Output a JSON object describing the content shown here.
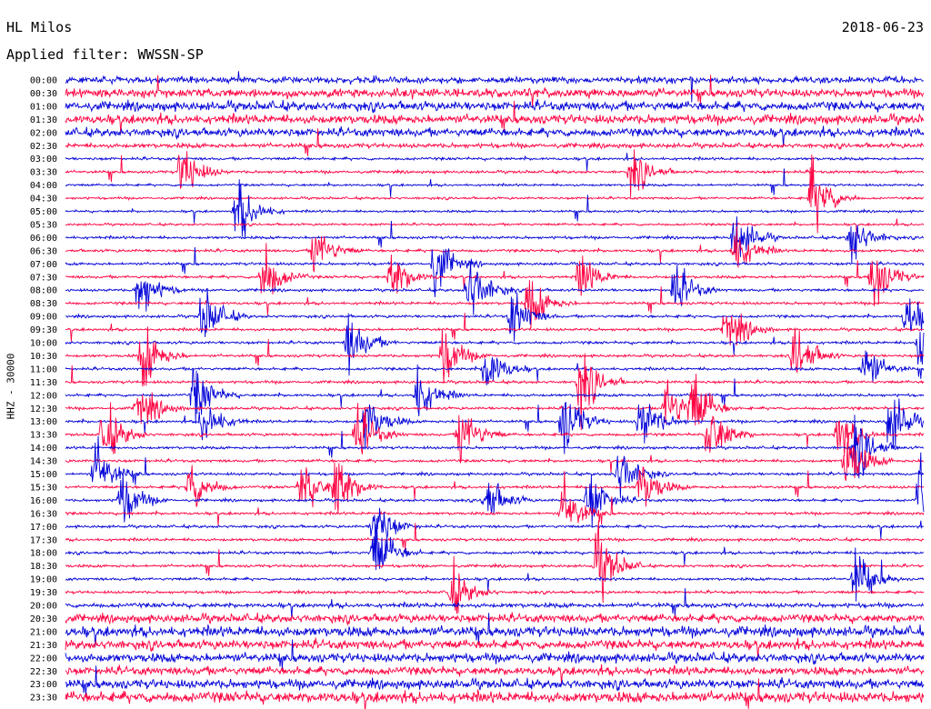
{
  "header": {
    "station": "HL Milos",
    "date": "2018-06-23",
    "filter": "Applied filter: WWSSN-SP",
    "channel": "HHZ - 30000"
  },
  "colors": {
    "trace_a": "#0000d8",
    "trace_b": "#ff0040",
    "background": "#ffffff"
  },
  "chart_data": {
    "type": "line",
    "title": "HL Milos",
    "subtitle": "Applied filter: WWSSN-SP",
    "ylabel": "HHZ - 30000",
    "y_ticks": [
      "00:00",
      "00:30",
      "01:00",
      "01:30",
      "02:00",
      "02:30",
      "03:00",
      "03:30",
      "04:00",
      "04:30",
      "05:00",
      "05:30",
      "06:00",
      "06:30",
      "07:00",
      "07:30",
      "08:00",
      "08:30",
      "09:00",
      "09:30",
      "10:00",
      "10:30",
      "11:00",
      "11:30",
      "12:00",
      "12:30",
      "13:00",
      "13:30",
      "14:00",
      "14:30",
      "15:00",
      "15:30",
      "16:00",
      "16:30",
      "17:00",
      "17:30",
      "18:00",
      "18:30",
      "19:00",
      "19:30",
      "20:00",
      "20:30",
      "21:00",
      "21:30",
      "22:00",
      "22:30",
      "23:00",
      "23:30"
    ],
    "series": [
      {
        "color": "#0000d8",
        "rows": "even (00:00, 01:00, ...)"
      },
      {
        "color": "#ff0040",
        "rows": "odd (00:30, 01:30, ...)"
      }
    ],
    "noise_level": [
      0.7,
      0.9,
      1.0,
      1.0,
      0.9,
      0.5,
      0.3,
      0.3,
      0.25,
      0.25,
      0.25,
      0.25,
      0.3,
      0.3,
      0.3,
      0.3,
      0.3,
      0.3,
      0.3,
      0.3,
      0.3,
      0.3,
      0.3,
      0.3,
      0.3,
      0.3,
      0.3,
      0.3,
      0.3,
      0.3,
      0.3,
      0.3,
      0.3,
      0.3,
      0.3,
      0.3,
      0.3,
      0.3,
      0.3,
      0.3,
      0.5,
      0.9,
      1.1,
      1.0,
      1.0,
      0.9,
      1.0,
      1.2
    ],
    "events": [
      {
        "time": "03:30",
        "minute": 13.5,
        "amp": 1.0
      },
      {
        "time": "03:30",
        "minute": 66.0,
        "amp": 0.8
      },
      {
        "time": "04:30",
        "minute": 87.0,
        "amp": 1.3
      },
      {
        "time": "05:00",
        "minute": 20.0,
        "amp": 1.2
      },
      {
        "time": "06:00",
        "minute": 78.0,
        "amp": 1.0
      },
      {
        "time": "06:00",
        "minute": 91.5,
        "amp": 0.9
      },
      {
        "time": "06:30",
        "minute": 29.0,
        "amp": 0.9
      },
      {
        "time": "06:30",
        "minute": 78.0,
        "amp": 0.9
      },
      {
        "time": "07:00",
        "minute": 43.0,
        "amp": 1.1
      },
      {
        "time": "07:30",
        "minute": 23.0,
        "amp": 1.1
      },
      {
        "time": "07:30",
        "minute": 38.0,
        "amp": 0.9
      },
      {
        "time": "07:30",
        "minute": 60.0,
        "amp": 0.8
      },
      {
        "time": "07:30",
        "minute": 94.0,
        "amp": 1.2
      },
      {
        "time": "08:00",
        "minute": 8.5,
        "amp": 1.0
      },
      {
        "time": "08:00",
        "minute": 47.0,
        "amp": 1.3
      },
      {
        "time": "08:00",
        "minute": 71.0,
        "amp": 0.9
      },
      {
        "time": "08:30",
        "minute": 54.0,
        "amp": 1.0
      },
      {
        "time": "09:00",
        "minute": 16.0,
        "amp": 1.0
      },
      {
        "time": "09:00",
        "minute": 52.0,
        "amp": 0.9
      },
      {
        "time": "09:00",
        "minute": 98.0,
        "amp": 0.9
      },
      {
        "time": "09:30",
        "minute": 77.0,
        "amp": 1.0
      },
      {
        "time": "10:00",
        "minute": 33.0,
        "amp": 1.1
      },
      {
        "time": "10:00",
        "minute": 99.5,
        "amp": 1.0
      },
      {
        "time": "10:30",
        "minute": 9.0,
        "amp": 1.2
      },
      {
        "time": "10:30",
        "minute": 44.0,
        "amp": 1.0
      },
      {
        "time": "10:30",
        "minute": 85.0,
        "amp": 1.1
      },
      {
        "time": "11:00",
        "minute": 49.0,
        "amp": 1.0
      },
      {
        "time": "11:00",
        "minute": 93.0,
        "amp": 0.9
      },
      {
        "time": "11:30",
        "minute": 60.0,
        "amp": 1.2
      },
      {
        "time": "12:00",
        "minute": 15.0,
        "amp": 1.0
      },
      {
        "time": "12:00",
        "minute": 41.0,
        "amp": 1.0
      },
      {
        "time": "12:30",
        "minute": 8.5,
        "amp": 0.9
      },
      {
        "time": "12:30",
        "minute": 70.0,
        "amp": 1.0
      },
      {
        "time": "12:30",
        "minute": 73.0,
        "amp": 1.2
      },
      {
        "time": "13:00",
        "minute": 16.0,
        "amp": 0.9
      },
      {
        "time": "13:00",
        "minute": 35.0,
        "amp": 1.0
      },
      {
        "time": "13:00",
        "minute": 58.0,
        "amp": 1.2
      },
      {
        "time": "13:00",
        "minute": 67.0,
        "amp": 1.1
      },
      {
        "time": "13:00",
        "minute": 96.0,
        "amp": 1.2
      },
      {
        "time": "13:30",
        "minute": 4.5,
        "amp": 1.1
      },
      {
        "time": "13:30",
        "minute": 34.0,
        "amp": 1.0
      },
      {
        "time": "13:30",
        "minute": 46.0,
        "amp": 1.1
      },
      {
        "time": "13:30",
        "minute": 75.0,
        "amp": 1.2
      },
      {
        "time": "13:30",
        "minute": 90.0,
        "amp": 1.0
      },
      {
        "time": "14:00",
        "minute": 92.0,
        "amp": 1.1
      },
      {
        "time": "14:30",
        "minute": 91.0,
        "amp": 1.2
      },
      {
        "time": "15:00",
        "minute": 3.5,
        "amp": 1.1
      },
      {
        "time": "15:00",
        "minute": 64.5,
        "amp": 1.0
      },
      {
        "time": "15:30",
        "minute": 14.5,
        "amp": 0.9
      },
      {
        "time": "15:30",
        "minute": 27.5,
        "amp": 1.0
      },
      {
        "time": "15:30",
        "minute": 31.5,
        "amp": 1.2
      },
      {
        "time": "15:30",
        "minute": 67.0,
        "amp": 1.0
      },
      {
        "time": "16:00",
        "minute": 6.5,
        "amp": 1.0
      },
      {
        "time": "16:00",
        "minute": 49.0,
        "amp": 0.9
      },
      {
        "time": "16:00",
        "minute": 61.0,
        "amp": 1.1
      },
      {
        "time": "16:00",
        "minute": 99.5,
        "amp": 1.3
      },
      {
        "time": "16:30",
        "minute": 58.0,
        "amp": 1.1
      },
      {
        "time": "17:00",
        "minute": 36.0,
        "amp": 1.0
      },
      {
        "time": "18:00",
        "minute": 36.0,
        "amp": 1.2
      },
      {
        "time": "18:30",
        "minute": 62.0,
        "amp": 1.3
      },
      {
        "time": "19:00",
        "minute": 92.0,
        "amp": 1.0
      },
      {
        "time": "19:30",
        "minute": 45.0,
        "amp": 0.9
      }
    ]
  }
}
